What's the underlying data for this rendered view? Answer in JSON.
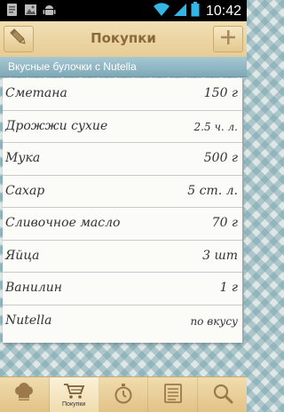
{
  "status_bar": {
    "time": "10:42"
  },
  "action_bar": {
    "title": "Покупки"
  },
  "recipe": {
    "title": "Вкусные булочки с Nutella"
  },
  "ingredients": [
    {
      "name": "Сметана",
      "quantity": "150 г"
    },
    {
      "name": "Дрожжи сухие",
      "quantity": "2.5 ч. л."
    },
    {
      "name": "Мука",
      "quantity": "500 г"
    },
    {
      "name": "Сахар",
      "quantity": "5 ст. л."
    },
    {
      "name": "Сливочное масло",
      "quantity": "70 г"
    },
    {
      "name": "Яйца",
      "quantity": "3 шт"
    },
    {
      "name": "Ванилин",
      "quantity": "1 г"
    },
    {
      "name": "Nutella",
      "quantity": "по вкусу"
    }
  ],
  "tabs": [
    {
      "icon": "chef-hat-icon",
      "label": ""
    },
    {
      "icon": "cart-icon",
      "label": "Покупки",
      "active": true
    },
    {
      "icon": "timer-icon",
      "label": ""
    },
    {
      "icon": "list-icon",
      "label": ""
    },
    {
      "icon": "search-icon",
      "label": ""
    }
  ],
  "colors": {
    "action_bar": "#e9d09c",
    "recipe_header": "#8fb6c3",
    "title_text": "#8a6a3a"
  }
}
